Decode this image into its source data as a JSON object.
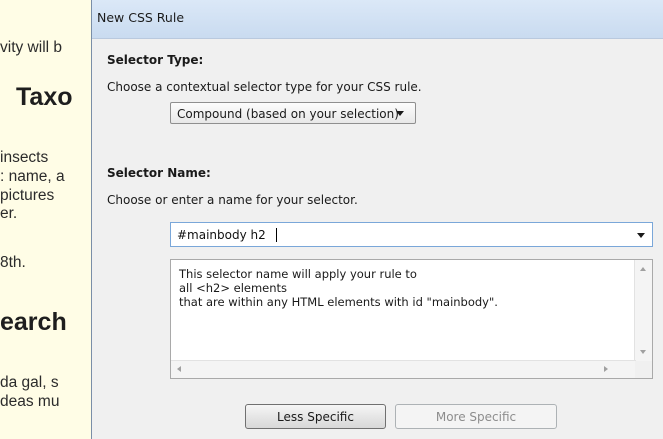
{
  "background_page": {
    "lines": [
      "vity will b",
      "Taxo",
      "insects",
      ": name, a",
      "pictures",
      "er.",
      "8th.",
      "earch",
      "da gal, s",
      "deas mu"
    ]
  },
  "dialog": {
    "title": "New CSS Rule",
    "selector_type": {
      "heading": "Selector Type:",
      "description": "Choose a contextual selector type for your CSS rule.",
      "selected_value": "Compound (based on your selection)"
    },
    "selector_name": {
      "heading": "Selector Name:",
      "description": "Choose or enter a name for your selector.",
      "value": "#mainbody h2"
    },
    "info": {
      "lines": [
        "This selector name will apply your rule to",
        "all <h2> elements",
        "that are within any HTML elements with id \"mainbody\"."
      ]
    },
    "buttons": {
      "less_specific": "Less Specific",
      "more_specific": "More Specific"
    }
  }
}
